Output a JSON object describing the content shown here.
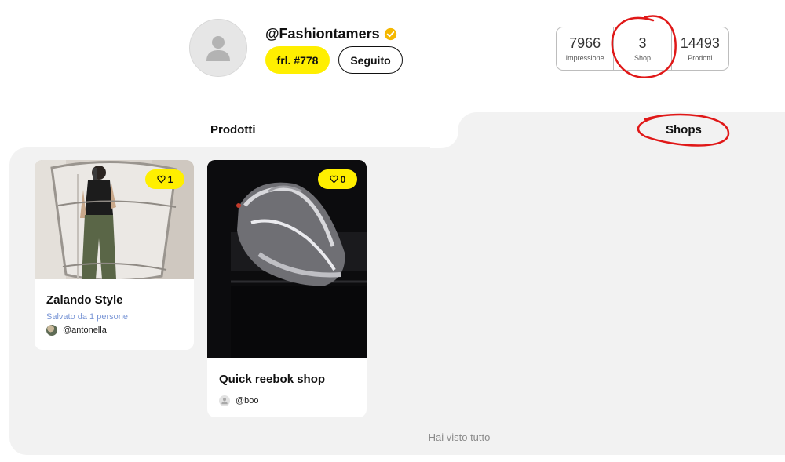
{
  "profile": {
    "username": "@Fashiontamers",
    "rank_label": "frl. #778",
    "follow_label": "Seguito"
  },
  "stats": [
    {
      "value": "7966",
      "label": "Impressione"
    },
    {
      "value": "3",
      "label": "Shop"
    },
    {
      "value": "14493",
      "label": "Prodotti"
    }
  ],
  "tabs": {
    "products_label": "Prodotti",
    "shops_label": "Shops"
  },
  "cards": [
    {
      "likes": "1",
      "title": "Zalando Style",
      "subtitle": "Salvato da 1 persone",
      "user": "@antonella"
    },
    {
      "likes": "0",
      "title": "Quick reebok shop",
      "subtitle": "",
      "user": "@boo"
    }
  ],
  "footer": {
    "end_text": "Hai visto tutto"
  },
  "colors": {
    "accent_yellow": "#ffef00",
    "verified_badge": "#f5b800",
    "annotation_red": "#e01818",
    "subtitle_blue": "#7a96d6",
    "panel_gray": "#f2f2f2"
  },
  "icons": [
    "user-placeholder-icon",
    "verified-icon",
    "heart-icon"
  ]
}
